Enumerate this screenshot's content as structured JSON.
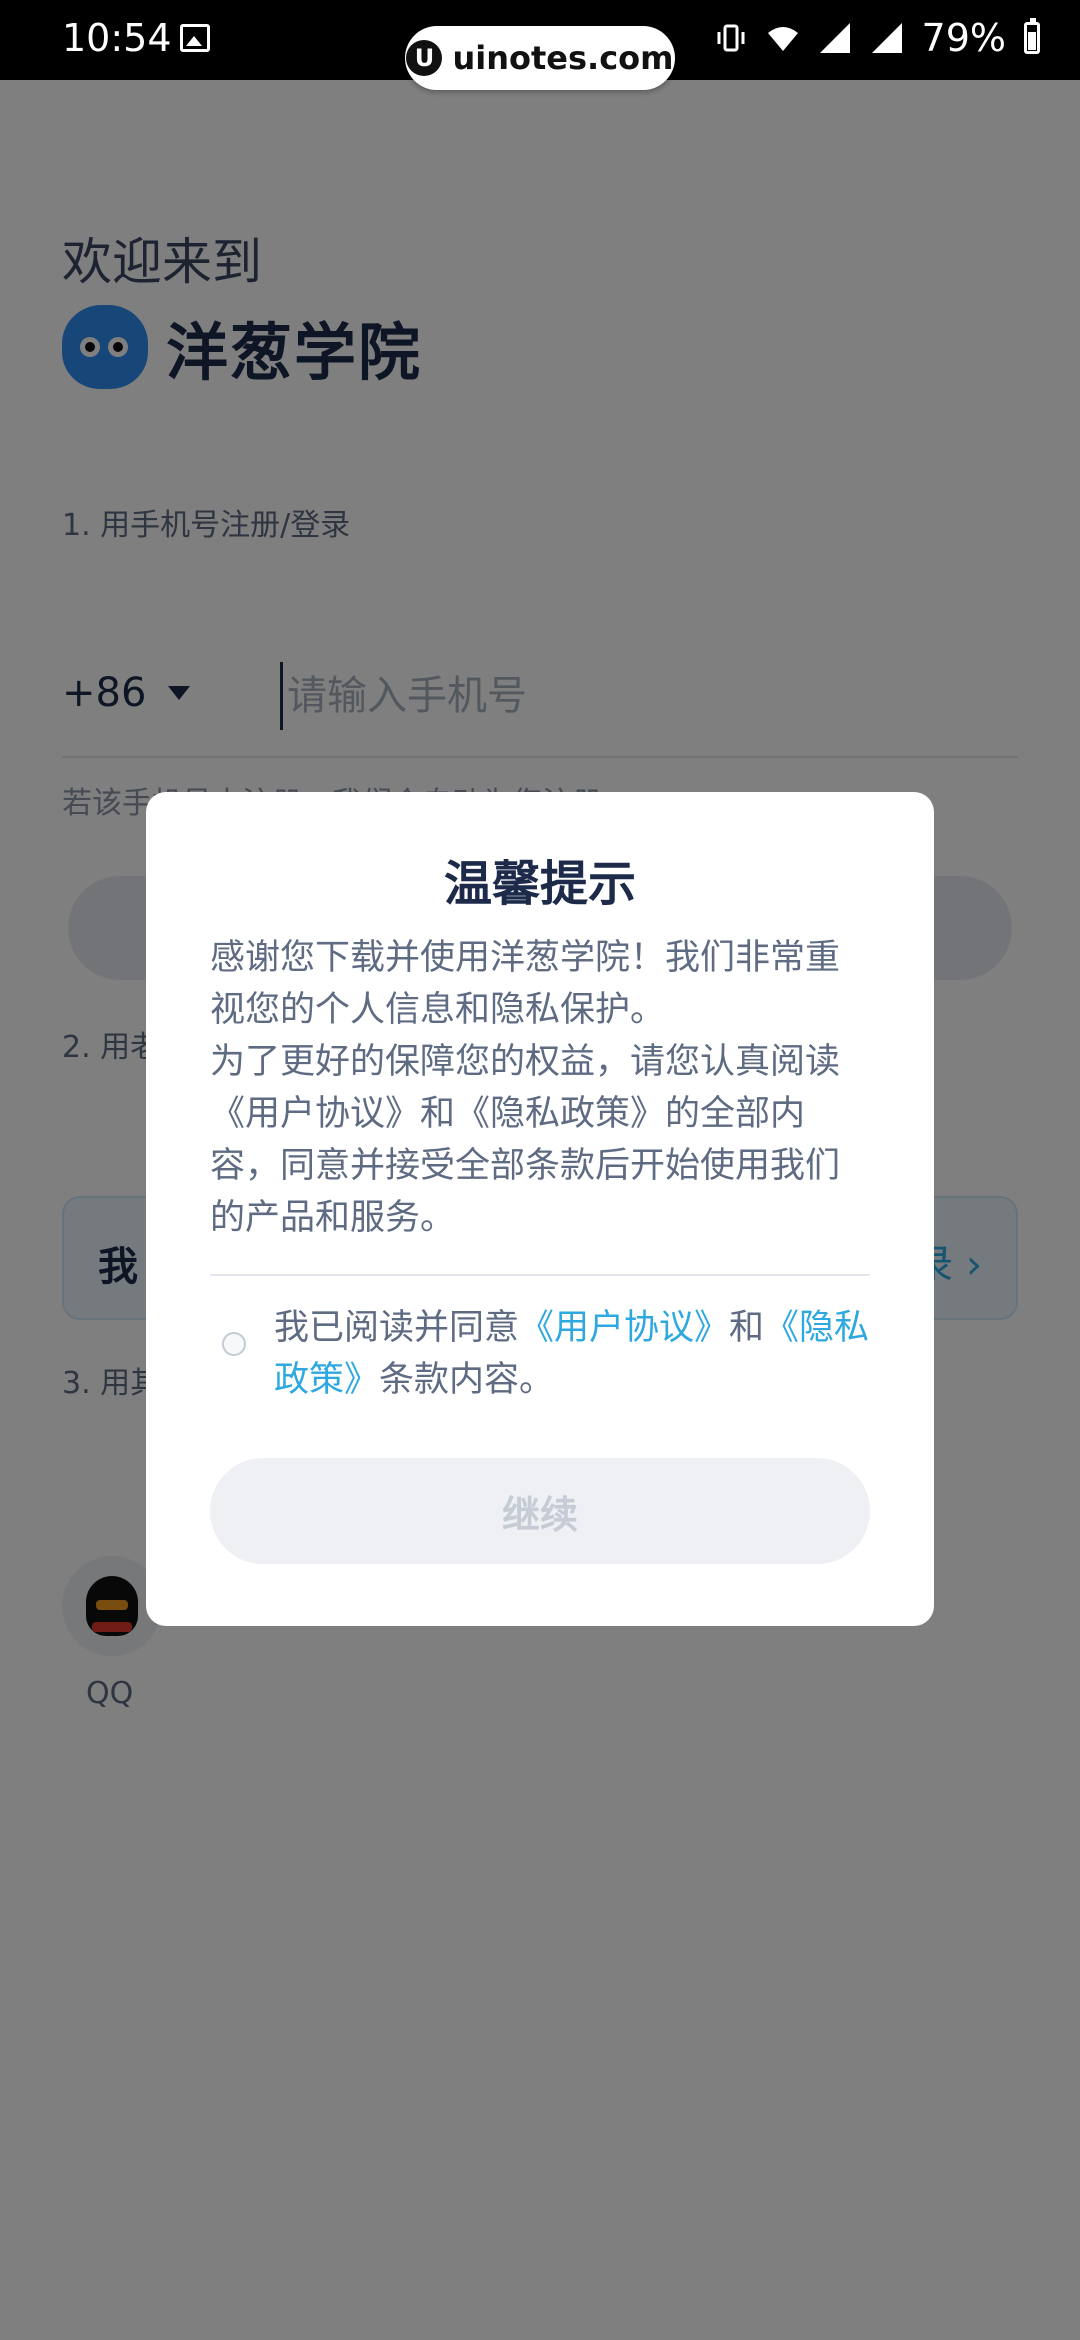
{
  "status_bar": {
    "time": "10:54",
    "battery": "79%",
    "watermark": "uinotes.com",
    "watermark_logo_letter": "U"
  },
  "page": {
    "welcome": "欢迎来到",
    "brand_name": "洋葱学院",
    "section1_label": "1. 用手机号注册/登录",
    "country_code": "+86",
    "phone_placeholder": "请输入手机号",
    "phone_hint": "若该手机号未注册，我们会自动为您注册",
    "section2_label": "2. 用老",
    "old_account_text": "我",
    "old_account_right": "录 ›",
    "section3_label": "3. 用其",
    "qq_label": "QQ"
  },
  "dialog": {
    "title": "温馨提示",
    "paragraph1": "感谢您下载并使用洋葱学院！我们非常重视您的个人信息和隐私保护。",
    "paragraph2": "为了更好的保障您的权益，请您认真阅读《用户协议》和《隐私政策》的全部内容，同意并接受全部条款后开始使用我们的产品和服务。",
    "agree_prefix": "我已阅读并同意",
    "user_agreement_link": "《用户协议》",
    "agree_and": "和",
    "privacy_policy_link": "《隐私政策》",
    "agree_suffix": "条款内容。",
    "continue_label": "继续"
  },
  "colors": {
    "accent": "#2ea8e0",
    "text_primary": "#1d2a4a",
    "text_secondary": "#5e6b82",
    "overlay": "rgba(0,0,0,0.5)"
  }
}
